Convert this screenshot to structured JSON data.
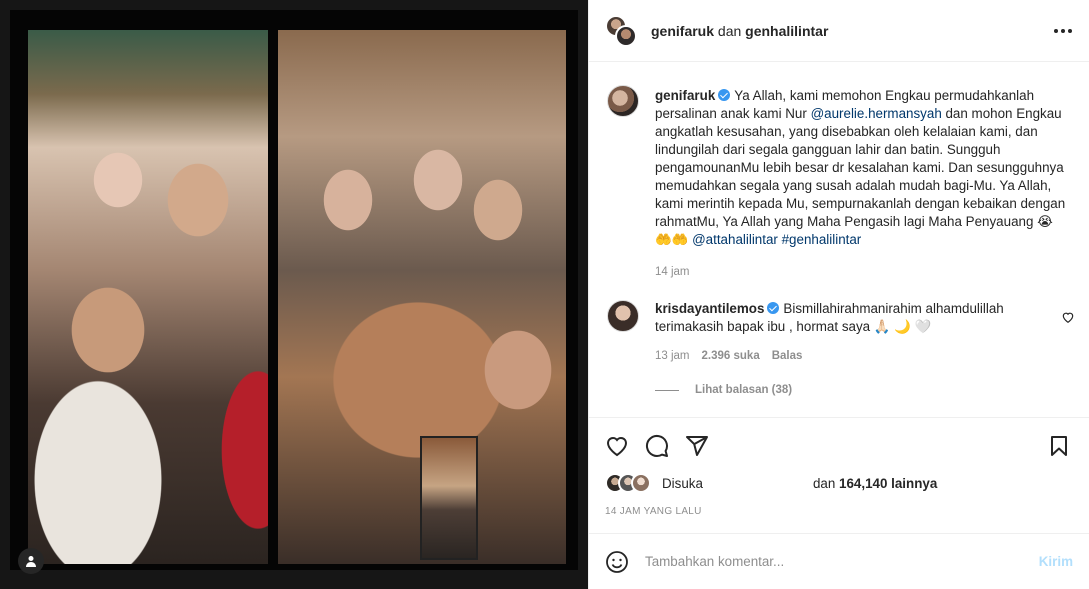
{
  "header": {
    "user1": "genifaruk",
    "conj": "dan",
    "user2": "genhalilintar"
  },
  "caption": {
    "username": "genifaruk",
    "text1": "Ya Allah, kami memohon Engkau permudahkanlah persalinan anak kami Nur ",
    "mention1": "@aurelie.hermansyah",
    "text2": " dan mohon Engkau angkatlah kesusahan, yang disebabkan oleh kelalaian kami, dan lindungilah dari segala gangguan lahir dan batin. Sungguh pengamounanMu lebih besar dr kesalahan kami. Dan sesungguhnya memudahkan segala yang susah adalah mudah bagi-Mu. Ya Allah, kami merintih kepada Mu, sempurnakanlah dengan kebaikan dengan rahmatMu, Ya Allah yang Maha Pengasih lagi Maha Penyauang 😭 🤲🤲 ",
    "mention2": "@attahalilintar",
    "hashtag": "#genhalilintar",
    "time": "14 jam"
  },
  "comment": {
    "username": "krisdayantilemos",
    "text": "Bismillahirahmanirahim alhamdulillah terimakasih bapak ibu , hormat saya 🙏🏻 🌙 🤍",
    "time": "13 jam",
    "likes": "2.396 suka",
    "reply": "Balas",
    "view_replies": "Lihat balasan (38)"
  },
  "likes": {
    "prefix": "Disuka",
    "and": "dan",
    "count": "164,140 lainnya"
  },
  "timestamp": "14 JAM YANG LALU",
  "add_comment": {
    "placeholder": "Tambahkan komentar...",
    "post": "Kirim"
  }
}
